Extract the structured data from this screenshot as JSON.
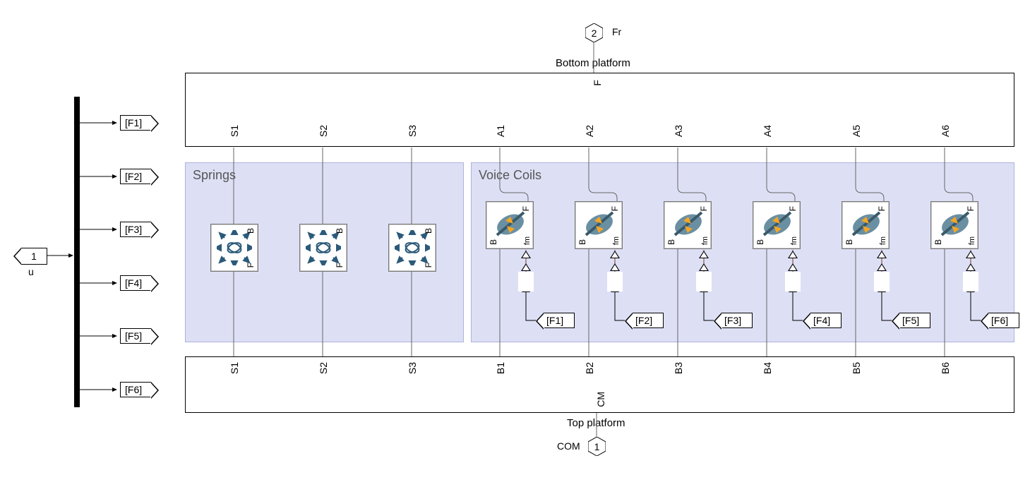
{
  "input": {
    "port_num": "1",
    "label": "u"
  },
  "outputs": {
    "fr": {
      "num": "2",
      "label": "Fr"
    },
    "com": {
      "num": "1",
      "label": "COM"
    }
  },
  "goto_tags": [
    "[F1]",
    "[F2]",
    "[F3]",
    "[F4]",
    "[F5]",
    "[F6]"
  ],
  "top_platform": {
    "title": "Bottom platform",
    "port_F": "F",
    "ports_S": [
      "S1",
      "S2",
      "S3"
    ],
    "ports_A": [
      "A1",
      "A2",
      "A3",
      "A4",
      "A5",
      "A6"
    ]
  },
  "bottom_platform": {
    "title": "Top platform",
    "port_CM": "CM",
    "ports_S": [
      "S1",
      "S2",
      "S3"
    ],
    "ports_B": [
      "B1",
      "B2",
      "B3",
      "B4",
      "B5",
      "B6"
    ]
  },
  "springs": {
    "title": "Springs",
    "blocks": [
      {
        "B": "B",
        "F": "F"
      },
      {
        "B": "B",
        "F": "F"
      },
      {
        "B": "B",
        "F": "F"
      }
    ]
  },
  "voice_coils": {
    "title": "Voice Coils",
    "blocks": [
      {
        "B": "B",
        "F": "F",
        "fm": "fm",
        "from": "[F1]"
      },
      {
        "B": "B",
        "F": "F",
        "fm": "fm",
        "from": "[F2]"
      },
      {
        "B": "B",
        "F": "F",
        "fm": "fm",
        "from": "[F3]"
      },
      {
        "B": "B",
        "F": "F",
        "fm": "fm",
        "from": "[F4]"
      },
      {
        "B": "B",
        "F": "F",
        "fm": "fm",
        "from": "[F5]"
      },
      {
        "B": "B",
        "F": "F",
        "fm": "fm",
        "from": "[F6]"
      }
    ]
  }
}
